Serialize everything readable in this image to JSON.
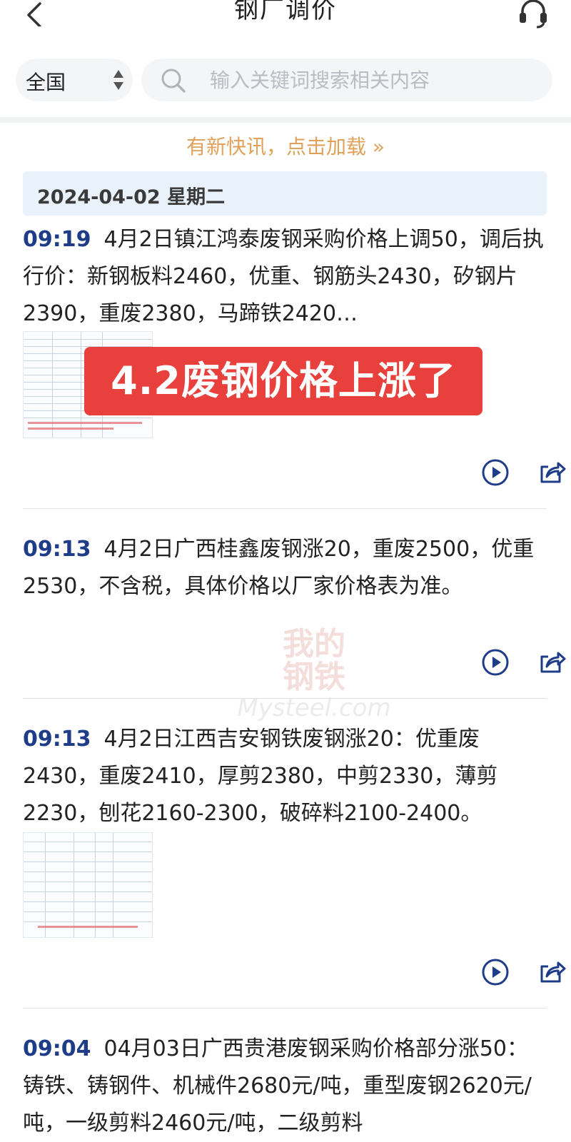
{
  "header": {
    "title": "钢厂调价"
  },
  "filter": {
    "region": "全国",
    "search_placeholder": "输入关键词搜索相关内容"
  },
  "load_more": "有新快讯，点击加载 »",
  "date_label": "2024-04-02 星期二",
  "banner_text": "4.2废钢价格上涨了",
  "watermark": {
    "cn_line1": "我的",
    "cn_line2": "钢铁",
    "en": "Mysteel.com"
  },
  "news": [
    {
      "time": "09:19",
      "text": "4月2日镇江鸿泰废钢采购价格上调50，调后执行价：新钢板料2460，优重、钢筋头2430，矽钢片2390，重废2380，马蹄铁2420…"
    },
    {
      "time": "09:13",
      "text": "4月2日广西桂鑫废钢涨20，重废2500，优重2530，不含税，具体价格以厂家价格表为准。"
    },
    {
      "time": "09:13",
      "text": "4月2日江西吉安钢铁废钢涨20：优重废2430，重废2410，厚剪2380，中剪2330，薄剪2230，刨花2160-2300，破碎料2100-2400。"
    },
    {
      "time": "09:04",
      "text": "04月03日广西贵港废钢采购价格部分涨50：铸铁、铸钢件、机械件2680元/吨，重型废钢2620元/吨，一级剪料2460元/吨，二级剪料"
    }
  ],
  "colors": {
    "time": "#1f3c88",
    "accent_orange": "#e0a15a",
    "banner_red": "#e8403c",
    "date_bar_bg": "#e9f1fa"
  }
}
